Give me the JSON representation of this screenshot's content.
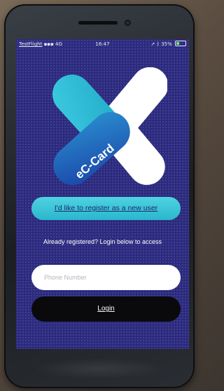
{
  "statusbar": {
    "carrier": "TestFlight",
    "signal": "4G",
    "time": "16:47",
    "battery": "35%",
    "battery_level": 0.35
  },
  "logo": {
    "text": "eC-Card",
    "colors": {
      "cyan": "#2bb8d2",
      "blue": "#1f58b9",
      "white": "#ffffff"
    }
  },
  "register": {
    "label": "I'd like to register as a new user"
  },
  "login_prompt": "Already registered? Login below to access",
  "phone_field": {
    "placeholder": "Phone Number",
    "value": ""
  },
  "login": {
    "label": "Login"
  },
  "colors": {
    "background": "#2b2a7f",
    "register_button": "#3ec6d9",
    "login_button": "#0a0a0c"
  }
}
